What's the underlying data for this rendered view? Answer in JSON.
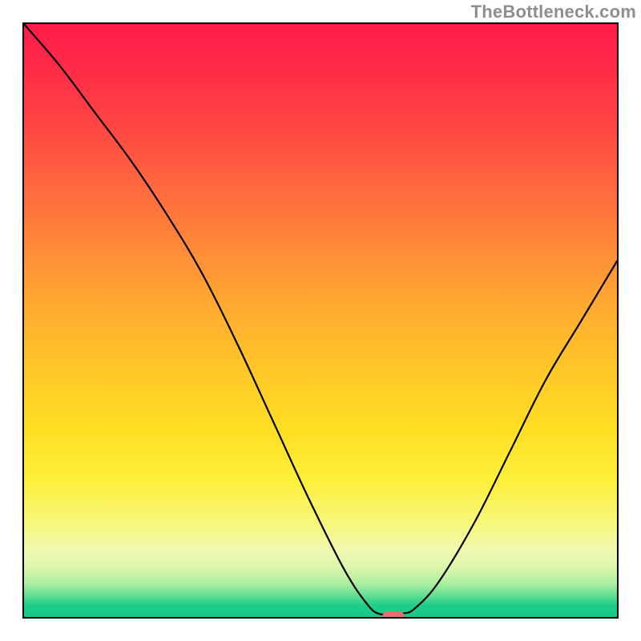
{
  "watermark": "TheBottleneck.com",
  "chart_data": {
    "type": "line",
    "title": "",
    "xlabel": "",
    "ylabel": "",
    "xlim": [
      0,
      100
    ],
    "ylim": [
      0,
      100
    ],
    "grid": false,
    "legend": false,
    "background_gradient": {
      "direction": "vertical",
      "stops": [
        {
          "pos": 0.0,
          "color": "#ff1c4b"
        },
        {
          "pos": 0.17,
          "color": "#ff4543"
        },
        {
          "pos": 0.38,
          "color": "#ff8b38"
        },
        {
          "pos": 0.58,
          "color": "#ffc628"
        },
        {
          "pos": 0.77,
          "color": "#fdef3a"
        },
        {
          "pos": 0.89,
          "color": "#f0f9b2"
        },
        {
          "pos": 0.96,
          "color": "#5fdd93"
        },
        {
          "pos": 1.0,
          "color": "#17c887"
        }
      ]
    },
    "series": [
      {
        "name": "bottleneck-curve",
        "color": "#000000",
        "x": [
          0,
          6,
          12,
          18,
          24,
          30,
          36,
          42,
          48,
          54,
          58,
          60,
          62,
          64,
          66,
          70,
          76,
          82,
          88,
          94,
          100
        ],
        "y": [
          100,
          93,
          85,
          77,
          68,
          58,
          46,
          33,
          20,
          8,
          2,
          0.5,
          0.5,
          0.6,
          1.5,
          6,
          16,
          28,
          40,
          50,
          60
        ]
      }
    ],
    "marker": {
      "name": "optimal-point",
      "x": 62,
      "y": 0.5,
      "color": "#e76f6f",
      "shape": "pill"
    }
  }
}
